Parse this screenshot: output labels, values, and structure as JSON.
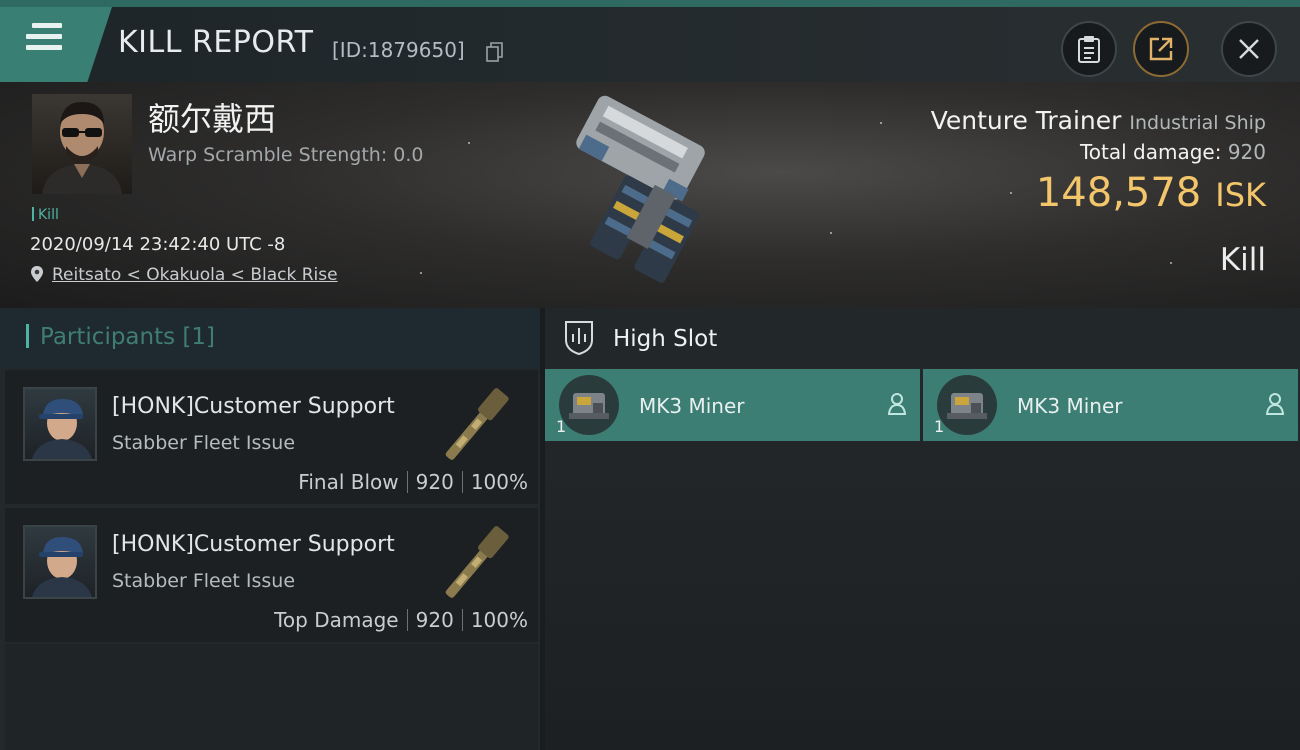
{
  "header": {
    "title": "KILL REPORT",
    "report_id": "[ID:1879650]",
    "icons": [
      "menu-icon",
      "copy-icon",
      "clipboard-icon",
      "share-icon",
      "close-icon"
    ]
  },
  "victim": {
    "name": "额尔戴西",
    "warp_scramble": "Warp Scramble Strength: 0.0",
    "tag": "Kill",
    "timestamp": "2020/09/14 23:42:40 UTC -8",
    "location": "Reitsato < Okakuola < Black Rise"
  },
  "ship": {
    "name": "Venture Trainer",
    "class": "Industrial Ship",
    "total_damage_label": "Total damage:",
    "total_damage": "920",
    "isk_value": "148,578",
    "isk_unit": "ISK",
    "result": "Kill"
  },
  "participants": {
    "title": "Participants",
    "count": "[1]",
    "rows": [
      {
        "name": "[HONK]Customer Support",
        "ship": "Stabber Fleet Issue",
        "role": "Final Blow",
        "damage": "920",
        "percent": "100%"
      },
      {
        "name": "[HONK]Customer Support",
        "ship": "Stabber Fleet Issue",
        "role": "Top Damage",
        "damage": "920",
        "percent": "100%"
      }
    ]
  },
  "high_slot": {
    "title": "High Slot",
    "modules": [
      {
        "name": "MK3 Miner",
        "qty": "1"
      },
      {
        "name": "MK3 Miner",
        "qty": "1"
      }
    ]
  },
  "colors": {
    "accent_teal": "#3c7d74",
    "isk_gold": "#f3c66b",
    "header_stripe": "#2f6a62"
  }
}
